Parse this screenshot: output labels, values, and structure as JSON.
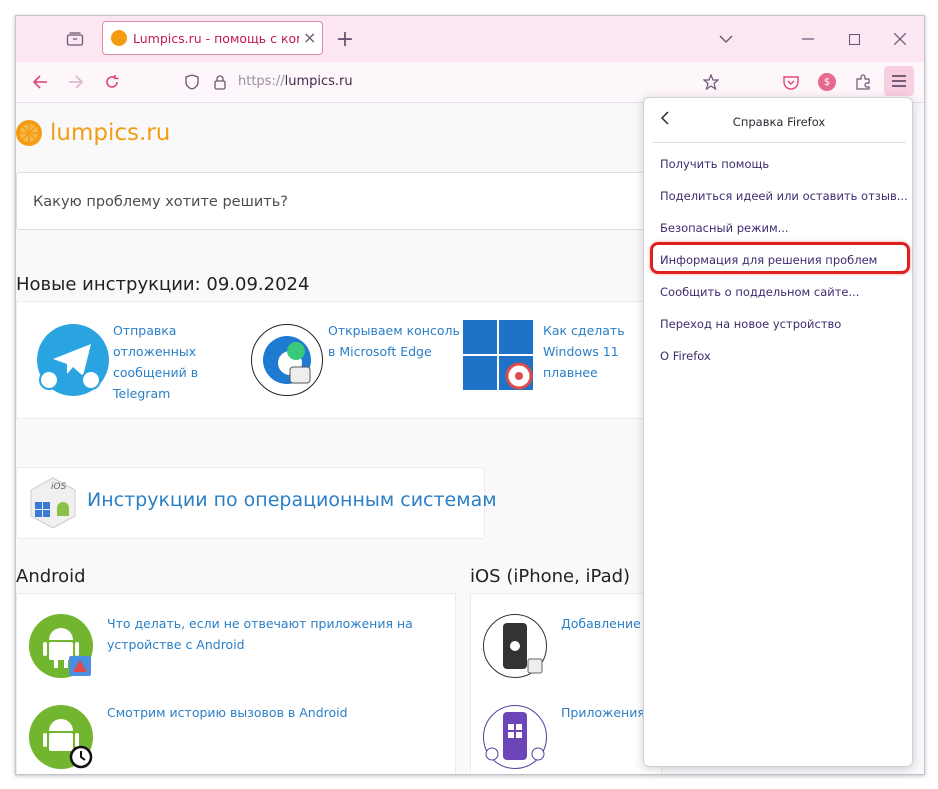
{
  "browser": {
    "tab_title": "Lumpics.ru - помощь с компьютером",
    "url_scheme": "https://",
    "url_host": "lumpics.ru",
    "ext_badge": "$"
  },
  "site": {
    "logo_text": "lumpics.ru",
    "search_placeholder": "Какую проблему хотите решить?",
    "new_heading": "Новые инструкции: 09.09.2024",
    "new_articles": [
      {
        "text": "Отправка отложенных сообщений в Telegram"
      },
      {
        "text": "Открываем консоль в Microsoft Edge"
      },
      {
        "text": "Как сделать Windows 11 плавнее"
      }
    ],
    "os_banner": "Инструкции по операционным системам",
    "os_badge": "iOS",
    "android_heading": "Android",
    "ios_heading": "iOS (iPhone, iPad)",
    "android_articles": [
      {
        "text": "Что делать, если не отвечают приложения на устройстве с Android"
      },
      {
        "text": "Смотрим историю вызовов в Android"
      }
    ],
    "ios_articles": [
      {
        "text": "Добавление ..."
      },
      {
        "text": "Приложения ..."
      }
    ]
  },
  "menu": {
    "title": "Справка Firefox",
    "items": [
      {
        "label": "Получить помощь"
      },
      {
        "label": "Поделиться идеей или оставить отзыв..."
      },
      {
        "label": "Безопасный режим..."
      },
      {
        "label": "Информация для решения проблем"
      },
      {
        "label": "Сообщить о поддельном сайте..."
      },
      {
        "label": "Переход на новое устройство"
      },
      {
        "label": "О Firefox"
      }
    ],
    "highlighted_index": 3
  },
  "colors": {
    "accent_orange": "#f39c12",
    "link_blue": "#2a7fc7",
    "highlight_red": "#e02020",
    "menu_text": "#3e2b6e"
  }
}
